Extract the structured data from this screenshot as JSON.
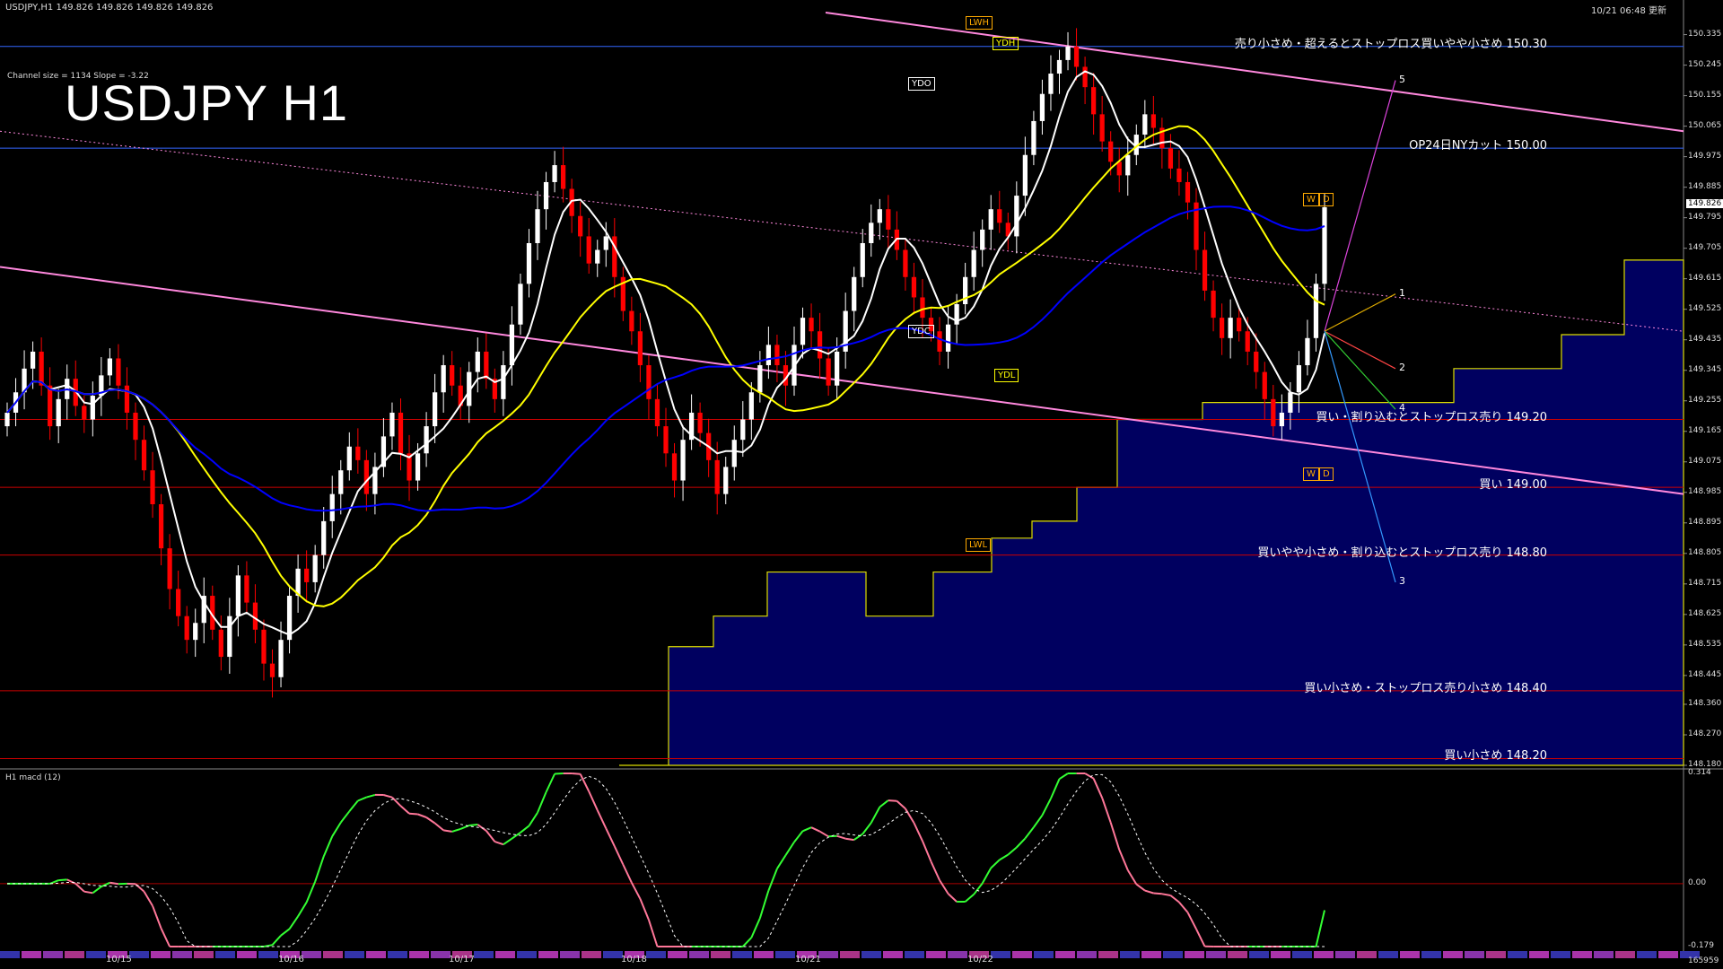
{
  "header": {
    "symbol_info": "USDJPY,H1  149.826 149.826 149.826 149.826",
    "update_time": "10/21 06:48 更新",
    "channel_info": "Channel size = 1134 Slope = -3.22",
    "title": "USDJPY H1",
    "current_price": "149.826"
  },
  "colors": {
    "background": "#000000",
    "bull_candle": "#ffffff",
    "bear_candle": "#ff0000",
    "sma_fast": "#ffffff",
    "sma_mid": "#ffff00",
    "sma_slow": "#0000ff",
    "channel": "#ff88dd",
    "level_line_red": "#cc0000",
    "level_line_blue": "#3366ff",
    "cloud_fill": "#000080",
    "macd_up": "#33ff33",
    "macd_down": "#ff7799"
  },
  "chart_data": [
    {
      "type": "candlestick",
      "title": "USDJPY H1",
      "ylim": [
        148.18,
        150.4
      ],
      "y_ticks": [
        "150.335",
        "150.245",
        "150.155",
        "150.065",
        "149.975",
        "149.885",
        "149.795",
        "149.705",
        "149.615",
        "149.525",
        "149.435",
        "149.345",
        "149.255",
        "149.165",
        "149.075",
        "148.985",
        "148.895",
        "148.805",
        "148.715",
        "148.625",
        "148.535",
        "148.445",
        "148.360",
        "148.270",
        "148.180"
      ],
      "date_labels": [
        "10/15",
        "10/16",
        "10/17",
        "10/18",
        "10/21",
        "10/22"
      ],
      "closes": [
        149.22,
        149.28,
        149.35,
        149.4,
        149.3,
        149.18,
        149.26,
        149.32,
        149.24,
        149.2,
        149.27,
        149.33,
        149.38,
        149.3,
        149.22,
        149.14,
        149.05,
        148.95,
        148.82,
        148.7,
        148.62,
        148.55,
        148.6,
        148.68,
        148.58,
        148.5,
        148.62,
        148.74,
        148.66,
        148.58,
        148.48,
        148.44,
        148.55,
        148.68,
        148.76,
        148.72,
        148.8,
        148.9,
        148.98,
        149.05,
        149.12,
        149.08,
        148.98,
        149.06,
        149.15,
        149.22,
        149.1,
        149.02,
        149.1,
        149.18,
        149.28,
        149.36,
        149.3,
        149.24,
        149.34,
        149.4,
        149.32,
        149.26,
        149.36,
        149.48,
        149.6,
        149.72,
        149.82,
        149.9,
        149.95,
        149.88,
        149.8,
        149.74,
        149.66,
        149.7,
        149.74,
        149.62,
        149.52,
        149.46,
        149.36,
        149.26,
        149.18,
        149.1,
        149.02,
        149.14,
        149.22,
        149.16,
        149.08,
        148.98,
        149.06,
        149.14,
        149.2,
        149.28,
        149.36,
        149.42,
        149.36,
        149.3,
        149.42,
        149.5,
        149.46,
        149.38,
        149.3,
        149.4,
        149.52,
        149.62,
        149.72,
        149.78,
        149.82,
        149.76,
        149.7,
        149.62,
        149.56,
        149.5,
        149.46,
        149.4,
        149.48,
        149.54,
        149.62,
        149.7,
        149.76,
        149.82,
        149.78,
        149.74,
        149.86,
        149.98,
        150.08,
        150.16,
        150.22,
        150.26,
        150.3,
        150.24,
        150.18,
        150.1,
        150.02,
        149.96,
        149.92,
        149.98,
        150.04,
        150.1,
        150.06,
        150.0,
        149.94,
        149.9,
        149.84,
        149.7,
        149.58,
        149.5,
        149.44,
        149.5,
        149.46,
        149.4,
        149.34,
        149.26,
        149.18,
        149.22,
        149.28,
        149.36,
        149.44,
        149.6,
        149.826
      ],
      "series": [
        {
          "name": "",
          "kind": "sma_fast"
        },
        {
          "name": "",
          "kind": "sma_mid"
        },
        {
          "name": "",
          "kind": "sma_slow"
        }
      ],
      "levels": [
        {
          "price": 150.3,
          "label": "売り小さめ・超えるとストップロス買いやや小さめ 150.30"
        },
        {
          "price": 150.0,
          "label": "OP24日NYカット 150.00"
        },
        {
          "price": 149.2,
          "label": "買い・割り込むとストップロス売り 149.20"
        },
        {
          "price": 149.0,
          "label": "買い 149.00"
        },
        {
          "price": 148.8,
          "label": "買いやや小さめ・割り込むとストップロス売り 148.80"
        },
        {
          "price": 148.4,
          "label": "買い小さめ・ストップロス売り小さめ 148.40"
        },
        {
          "price": 148.2,
          "label": "買い小さめ 148.20"
        }
      ],
      "marker_labels": [
        "LWH",
        "YDH",
        "YDO",
        "YDC",
        "YDL",
        "LWL",
        "W",
        "D",
        "W",
        "D"
      ],
      "scenario_labels": [
        "5",
        "1",
        "2",
        "4",
        "3"
      ]
    },
    {
      "type": "line",
      "title": "H1  macd (12)",
      "ylim": [
        -0.179,
        0.314
      ],
      "y_ticks": [
        "0.314",
        "0.00",
        "-0.179"
      ],
      "extra_label": "165959"
    }
  ]
}
